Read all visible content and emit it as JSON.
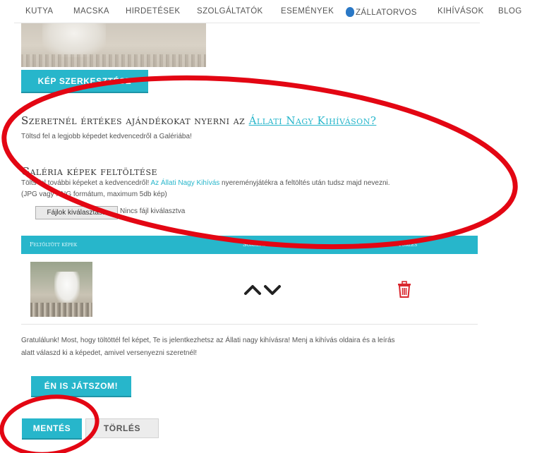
{
  "nav": {
    "items": [
      "KUTYA",
      "MACSKA",
      "HIRDETÉSEK",
      "SZOLGÁLTATÓK",
      "ESEMÉNYEK",
      "ZÁLLATORVOS",
      "KIHÍVÁSOK",
      "BLOG"
    ],
    "vet_icon": "drop-icon"
  },
  "image_edit_button": "KÉP SZERKESZTÉSE",
  "prize": {
    "heading_prefix": "Szeretnél értékes ajándékokat nyerni az ",
    "heading_link": "Állati Nagy Kihíváson?",
    "text": "Töltsd fel a legjobb képedet kedvencedről a Galériába!"
  },
  "gallery": {
    "heading": "Galéria képek feltöltése",
    "text_before_link": "Tölts fel további képeket a kedvencedről! ",
    "link": "Az Állati Nagy Kihívás",
    "text_after_link": " nyereményjátékra a feltöltés után tudsz majd nevezni.",
    "format_note": "(JPG vagy PNG formátum, maximum 5db kép)",
    "file_button": "Fájlok kiválasztása",
    "file_status": "Nincs fájl kiválasztva"
  },
  "table": {
    "headers": [
      "Feltöltött képek",
      "Sorrend",
      "Törlés"
    ],
    "icons": {
      "up": "chevron-up-icon",
      "down": "chevron-down-icon",
      "delete": "trash-icon"
    }
  },
  "congrats": {
    "line1": "Gratulálunk! Most, hogy töltöttél fel képet, Te is jelentkezhetsz az Állati nagy kihívásra! Menj a kihívás oldaira és a leírás",
    "line2": "alatt válaszd ki a képedet, amivel versenyezni szeretnél!"
  },
  "play_button": "ÉN IS JÁTSZOM!",
  "save_button": "MENTÉS",
  "delete_button": "TÖRLÉS",
  "colors": {
    "accent": "#27b6cb",
    "annotation": "#e30613",
    "delete_icon": "#d9272e"
  }
}
